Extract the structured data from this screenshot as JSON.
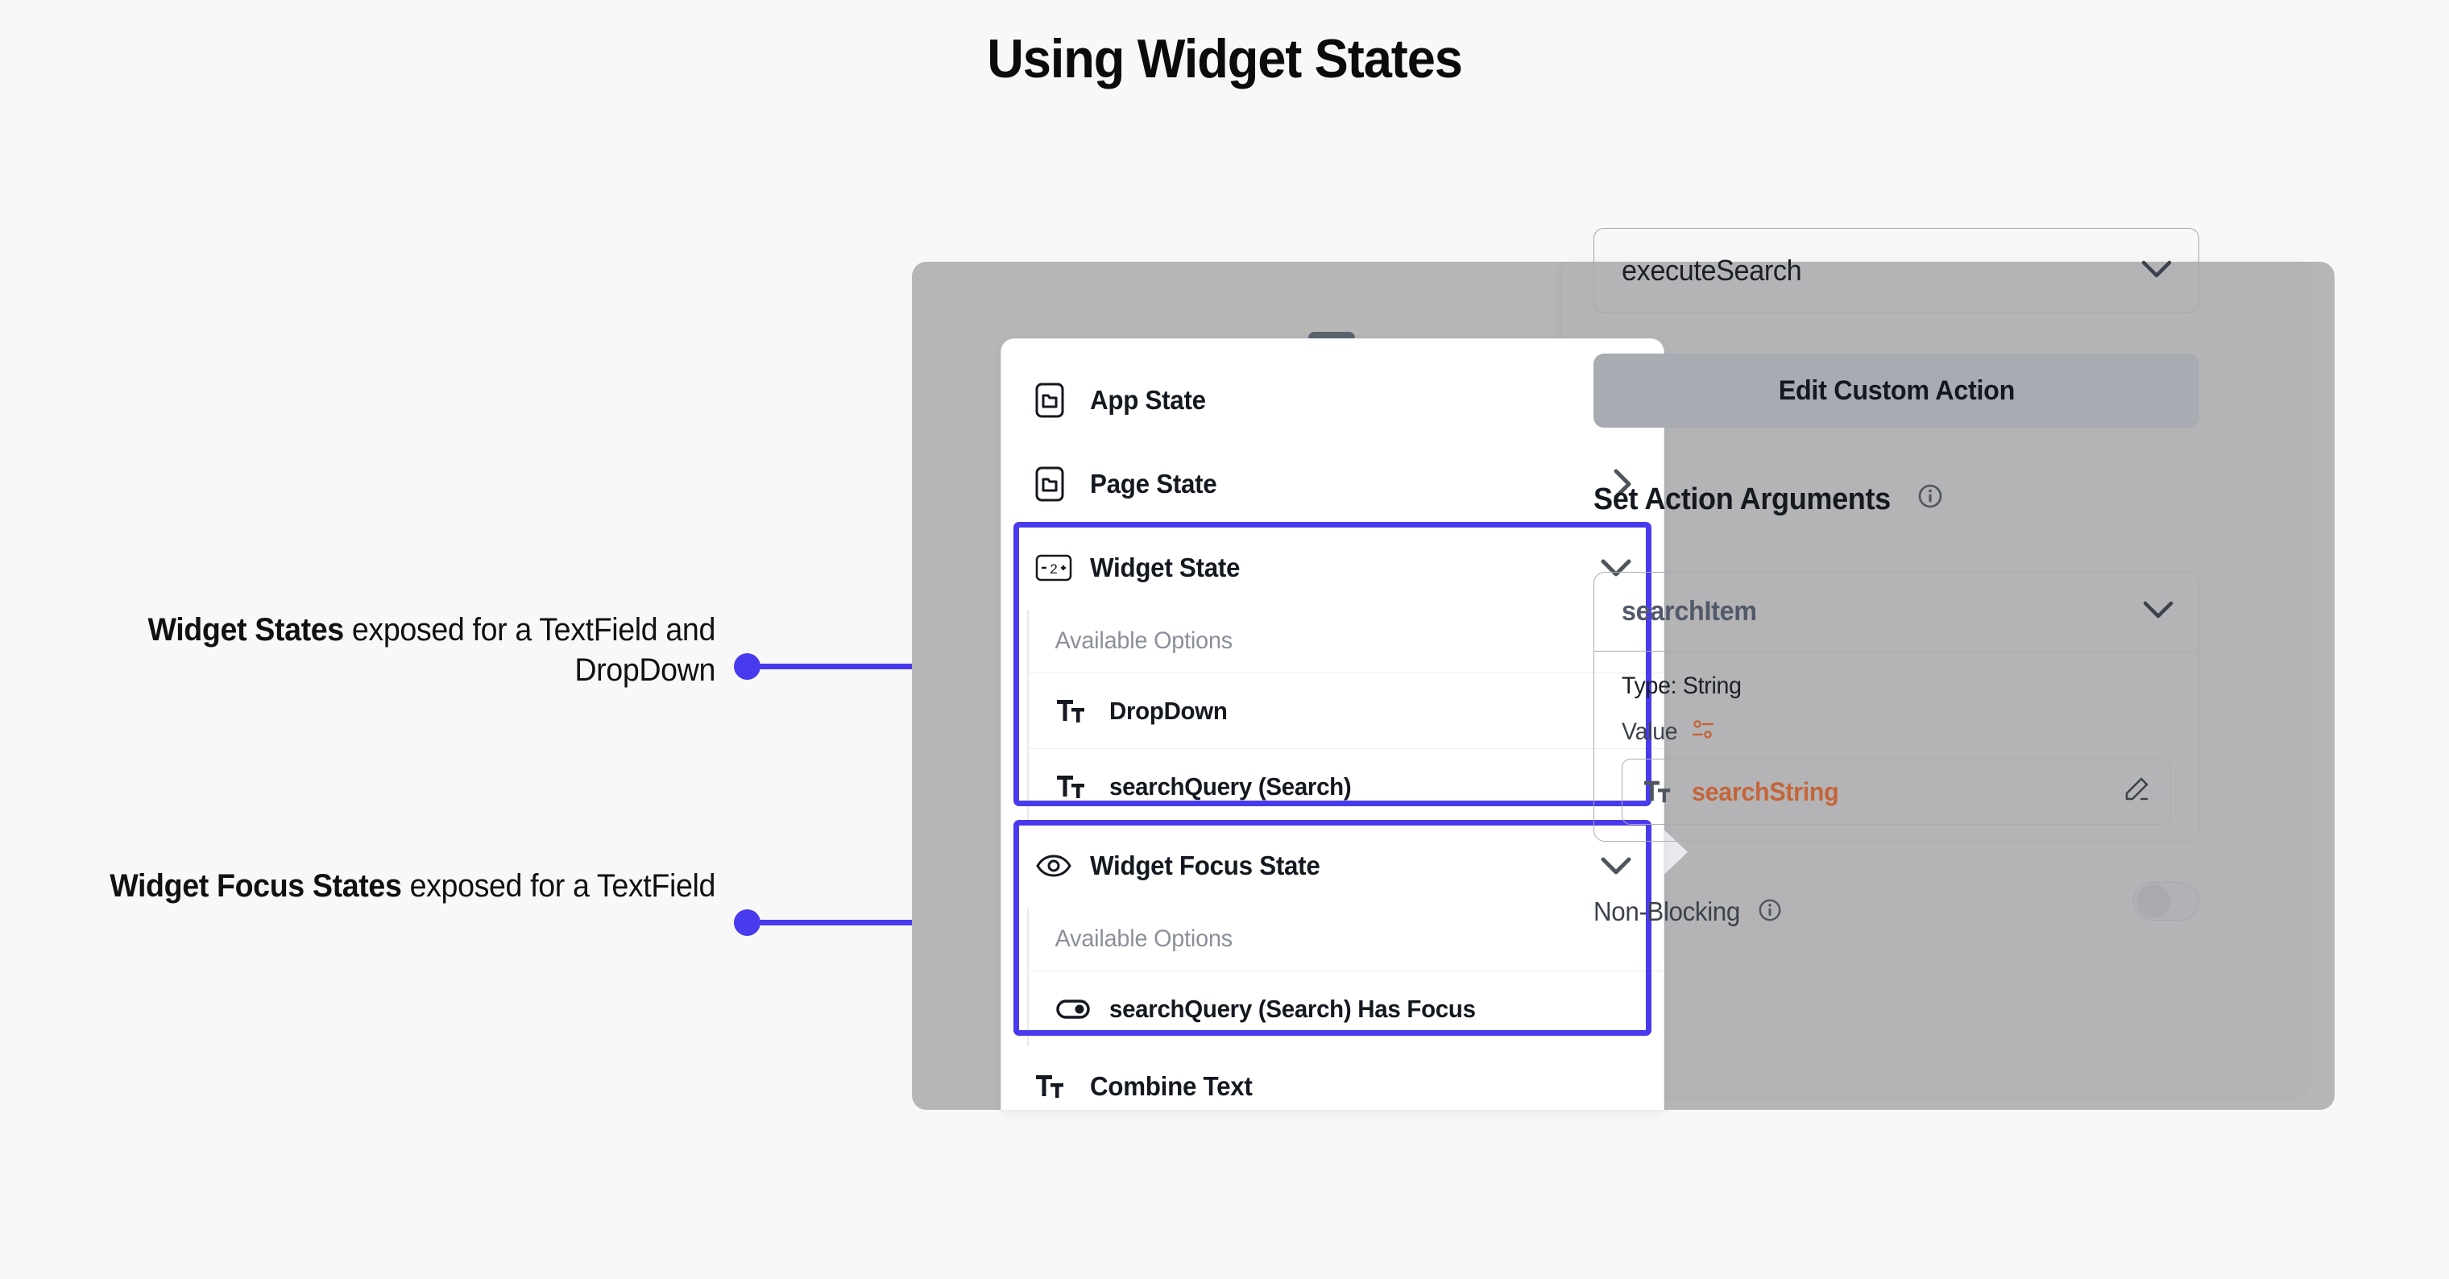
{
  "page": {
    "title": "Using Widget States",
    "background_color": "#f8f8f8",
    "accent_color": "#4a3aee"
  },
  "annotations": [
    {
      "id": "widget-states",
      "strong": "Widget States",
      "rest": " exposed for a TextField and DropDown"
    },
    {
      "id": "widget-focus-states",
      "strong": "Widget Focus States",
      "rest": " exposed for a TextField"
    }
  ],
  "dropdown_panel": {
    "grabber": "drag-handle",
    "rows": [
      {
        "label": "App State",
        "icon": "phone-state-icon",
        "chevron": "chevron-right-icon"
      },
      {
        "label": "Page State",
        "icon": "phone-state-icon",
        "chevron": "chevron-right-icon"
      }
    ],
    "widget_state": {
      "label": "Widget State",
      "icon": "counter-minus-2-plus-icon",
      "chevron": "chevron-down-icon",
      "available_options_label": "Available Options",
      "options": [
        {
          "label": "DropDown",
          "icon": "text-field-icon"
        },
        {
          "label": "searchQuery (Search)",
          "icon": "text-field-icon"
        }
      ]
    },
    "widget_focus_state": {
      "label": "Widget Focus State",
      "icon": "eye-icon",
      "chevron": "chevron-down-icon",
      "available_options_label": "Available Options",
      "options": [
        {
          "label": "searchQuery (Search) Has Focus",
          "icon": "toggle-icon"
        }
      ]
    },
    "footer_row": {
      "label": "Combine Text",
      "icon": "text-field-icon"
    }
  },
  "properties_panel": {
    "action_select": {
      "value": "executeSearch",
      "chevron": "chevron-down-icon"
    },
    "edit_button": {
      "label": "Edit Custom Action"
    },
    "section_heading": {
      "label": "Set Action Arguments",
      "info_icon": "info-icon"
    },
    "argument": {
      "name": "searchItem",
      "chevron": "chevron-down-icon",
      "type_label": "Type: String",
      "value_label": "Value",
      "value_icon": "variable-settings-icon",
      "value": {
        "text": "searchString",
        "icon": "text-field-icon",
        "color": "#c4653a",
        "edit_icon": "pencil-icon"
      }
    },
    "non_blocking": {
      "label": "Non-Blocking",
      "info_icon": "info-icon",
      "toggle_state": "off"
    }
  }
}
